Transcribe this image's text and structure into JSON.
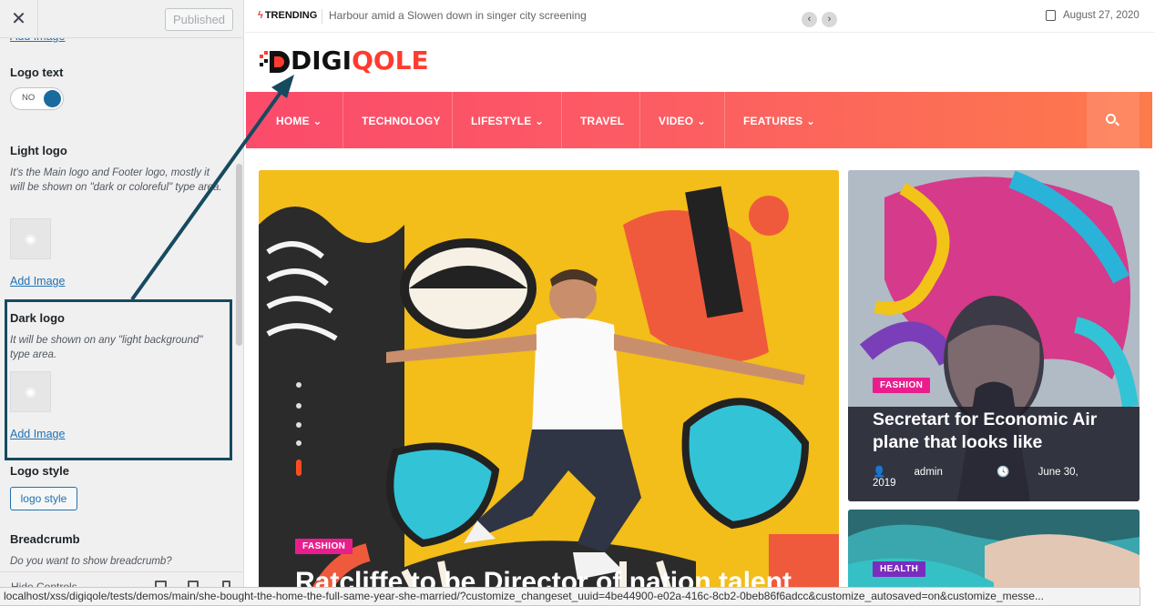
{
  "sidebar": {
    "close_label": "✕",
    "publish_label": "Published",
    "add_image_top": "Add Image",
    "logo_text": {
      "title": "Logo text",
      "toggle_label": "NO"
    },
    "light_logo": {
      "title": "Light logo",
      "description": "It's the Main logo and Footer logo, mostly it will be shown on \"dark or coloreful\" type area.",
      "add_image": "Add Image"
    },
    "dark_logo": {
      "title": "Dark logo",
      "description": "It will be shown on any \"light background\" type area.",
      "add_image": "Add Image"
    },
    "logo_style": {
      "title": "Logo style",
      "button": "logo style"
    },
    "breadcrumb": {
      "title": "Breadcrumb",
      "description": "Do you want to show breadcrumb?"
    },
    "footer": {
      "hide_controls": "Hide Controls"
    }
  },
  "preview": {
    "topbar": {
      "trending_label": "TRENDING",
      "trending_text": "Harbour amid a Slowen down in singer city screening",
      "date": "August 27, 2020"
    },
    "logo": {
      "part1": "DIGI",
      "part2": "QOLE"
    },
    "nav": {
      "items": [
        {
          "label": "HOME",
          "caret": true
        },
        {
          "label": "TECHNOLOGY",
          "caret": false
        },
        {
          "label": "LIFESTYLE",
          "caret": true
        },
        {
          "label": "TRAVEL",
          "caret": false
        },
        {
          "label": "VIDEO",
          "caret": true
        },
        {
          "label": "FEATURES",
          "caret": true
        }
      ]
    },
    "hero": {
      "category": "FASHION",
      "category_color": "#e91e8c",
      "title": "Ratcliffe to be Director of nation talent"
    },
    "card1": {
      "category": "FASHION",
      "category_color": "#e91e8c",
      "title": "Secretart for Economic Air plane that looks like",
      "author": "admin",
      "date": "June 30, 2019"
    },
    "card2": {
      "category": "HEALTH",
      "category_color": "#7b2cbf"
    }
  },
  "statusbar": {
    "url": "localhost/xss/digiqole/tests/demos/main/she-bought-the-home-the-full-same-year-she-married/?customize_changeset_uuid=4be44900-e02a-416c-8cb2-0beb86f6adcc&customize_autosaved=on&customize_messe..."
  },
  "colors": {
    "nav_gradient_start": "#fb4b6b",
    "nav_gradient_end": "#fd7a4c",
    "annotation": "#164a5f",
    "link": "#2271b1"
  }
}
